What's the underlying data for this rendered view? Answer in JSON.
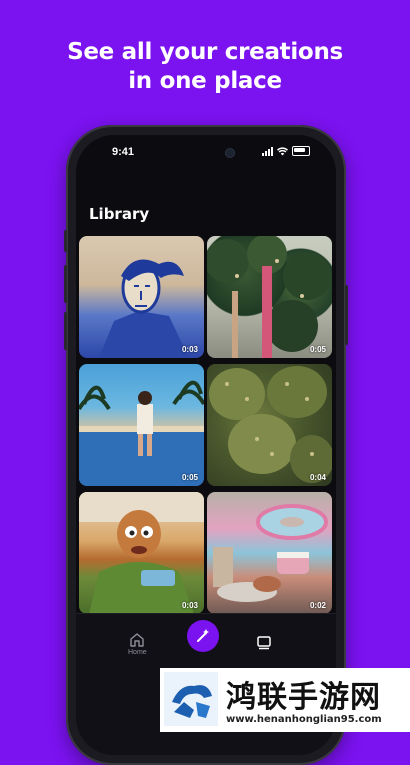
{
  "headline": {
    "line1": "See all your creations",
    "line2": "in one place"
  },
  "status_bar": {
    "time": "9:41"
  },
  "library": {
    "title": "Library",
    "items": [
      {
        "duration": "0:03",
        "subject": "portrait-sketch"
      },
      {
        "duration": "0:05",
        "subject": "trees"
      },
      {
        "duration": "0:05",
        "subject": "pool-scene"
      },
      {
        "duration": "0:04",
        "subject": "cactus"
      },
      {
        "duration": "0:03",
        "subject": "puppet-character"
      },
      {
        "duration": "0:02",
        "subject": "cake-still-life"
      }
    ]
  },
  "tab_bar": {
    "home_label": "Home"
  },
  "watermark": {
    "title": "鸿联手游网",
    "url": "www.henanhonglian95.com"
  },
  "colors": {
    "brand": "#7b12f0",
    "background": "#0c0b0f"
  }
}
